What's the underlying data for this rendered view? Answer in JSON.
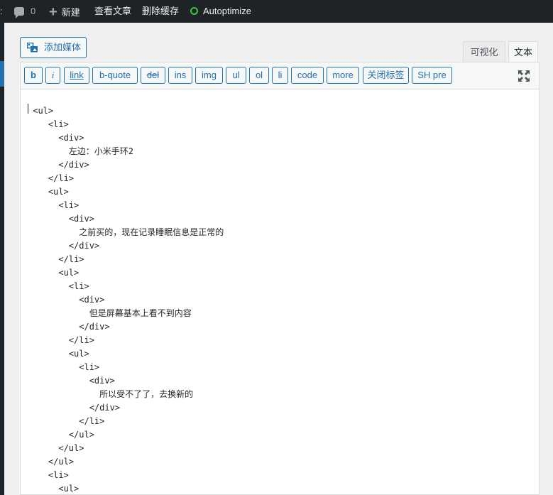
{
  "adminbar": {
    "edge_label": ":",
    "comments_count": "0",
    "new_label": "新建",
    "view_label": "查看文章",
    "cache_label": "删除缓存",
    "autoptimize_label": "Autoptimize"
  },
  "editor": {
    "add_media_label": "添加媒体",
    "tab_visual": "可视化",
    "tab_text": "文本",
    "quicktags": [
      "b",
      "i",
      "link",
      "b-quote",
      "del",
      "ins",
      "img",
      "ul",
      "ol",
      "li",
      "code",
      "more",
      "关闭标签",
      "SH pre"
    ],
    "code_lines": [
      "</div>",
      "",
      " <ul>",
      "    <li>",
      "      <div>",
      "        左边：小米手环2",
      "      </div>",
      "    </li>",
      "    <ul>",
      "      <li>",
      "        <div>",
      "          之前买的，现在记录睡眠信息是正常的",
      "        </div>",
      "      </li>",
      "      <ul>",
      "        <li>",
      "          <div>",
      "            但是屏幕基本上看不到内容",
      "          </div>",
      "        </li>",
      "        <ul>",
      "          <li>",
      "            <div>",
      "              所以受不了了，去换新的",
      "            </div>",
      "          </li>",
      "        </ul>",
      "      </ul>",
      "    </ul>",
      "    <li>",
      "      <ul>"
    ]
  },
  "colors": {
    "admin_bg": "#1d2327",
    "accent": "#2271b1",
    "status_green": "#3cc83c"
  }
}
